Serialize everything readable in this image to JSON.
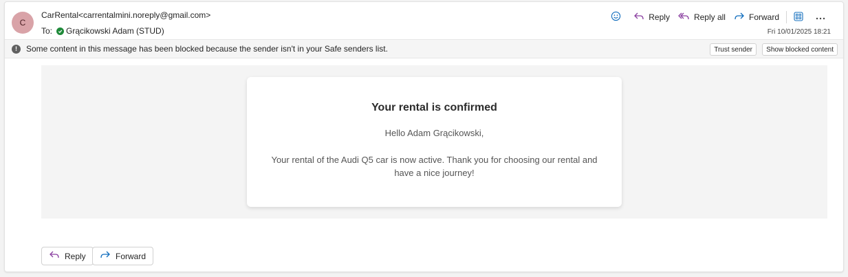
{
  "message": {
    "avatar_initial": "C",
    "from": "CarRental<carrentalmini.noreply@gmail.com>",
    "to_label": "To:",
    "to_name": "Grącikowski Adam (STUD)",
    "date": "Fri 10/01/2025 18:21"
  },
  "toolbar": {
    "reply": "Reply",
    "reply_all": "Reply all",
    "forward": "Forward",
    "icons": [
      "emoji-icon",
      "reply-icon",
      "reply-all-icon",
      "forward-icon",
      "apps-icon",
      "more-icon"
    ]
  },
  "info_bar": {
    "text": "Some content in this message has been blocked because the sender isn't in your Safe senders list.",
    "trust_sender": "Trust sender",
    "show_blocked": "Show blocked content"
  },
  "email": {
    "title": "Your rental is confirmed",
    "greeting": "Hello Adam Grącikowski,",
    "body": "Your rental of the Audi Q5 car is now active. Thank you for choosing our rental and have a nice journey!"
  },
  "footer": {
    "reply": "Reply",
    "forward": "Forward"
  },
  "colors": {
    "accent": "#8a3fa0",
    "avatar_bg": "#d9a3a8",
    "verified": "#1f8a3a"
  }
}
